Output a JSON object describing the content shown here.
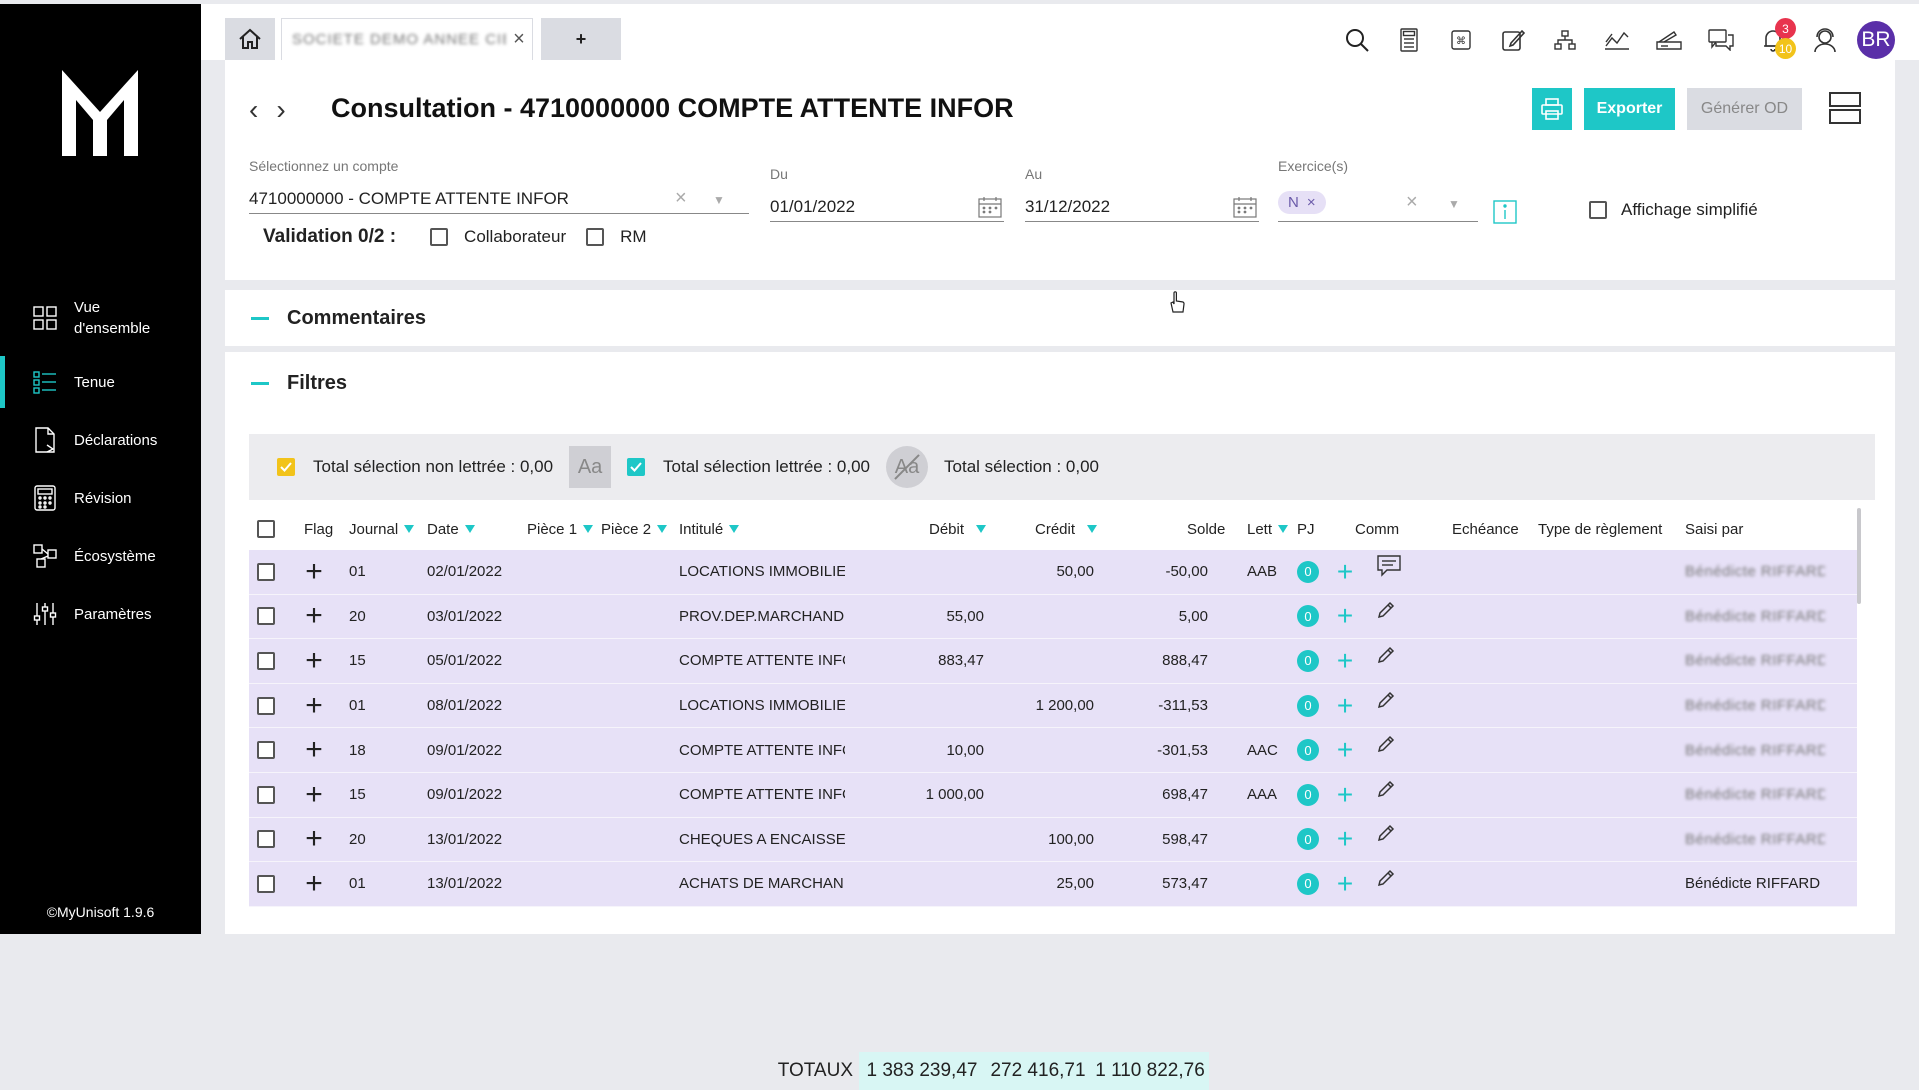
{
  "app": {
    "version": "©MyUnisoft 1.9.6",
    "logo": "MyUnisoft"
  },
  "colors": {
    "accent": "#1ec7c7",
    "sidebar": "#000000",
    "row_bg": "#e7e1f7",
    "badge_red": "#e8344e",
    "badge_yellow": "#f2c31a",
    "avatar": "#5a2fa8"
  },
  "sidebar": {
    "items": [
      {
        "label": "Vue d'ensemble",
        "icon": "grid-icon",
        "active": false
      },
      {
        "label": "Tenue",
        "icon": "list-icon",
        "active": true
      },
      {
        "label": "Déclarations",
        "icon": "document-icon",
        "active": false
      },
      {
        "label": "Révision",
        "icon": "calculator-icon",
        "active": false
      },
      {
        "label": "Écosystème",
        "icon": "ecosystem-icon",
        "active": false
      },
      {
        "label": "Paramètres",
        "icon": "sliders-icon",
        "active": false
      }
    ]
  },
  "tabs": {
    "home_icon": "home-icon",
    "doc_tab_label": "SOCIETE DEMO ANNEE CIBLE",
    "plus_label": "+"
  },
  "toolbar": {
    "icons": [
      "search-icon",
      "calculator-icon",
      "command-icon",
      "edit-icon",
      "network-icon",
      "chart-icon",
      "scanner-icon",
      "chat-icon",
      "bell-icon",
      "support-icon"
    ],
    "notif_red": "3",
    "notif_yellow": "10",
    "avatar": "BR"
  },
  "header": {
    "prev": "‹",
    "next": "›",
    "title": "Consultation - 4710000000 COMPTE ATTENTE INFOR",
    "export_label": "Exporter",
    "od_label": "Générer OD"
  },
  "form": {
    "account_label": "Sélectionnez un compte",
    "account_value": "4710000000 - COMPTE ATTENTE INFOR",
    "du_label": "Du",
    "du_value": "01/01/2022",
    "au_label": "Au",
    "au_value": "31/12/2022",
    "exercice_label": "Exercice(s)",
    "exercice_chip": "N",
    "simplified_label": "Affichage simplifié",
    "validation_label": "Validation 0/2 :",
    "collab_label": "Collaborateur",
    "rm_label": "RM"
  },
  "sections": {
    "comments": "Commentaires",
    "filters": "Filtres"
  },
  "selection": {
    "non_lettree": "Total sélection non lettrée : 0,00",
    "aa": "Aa",
    "lettree": "Total sélection lettrée : 0,00",
    "total": "Total sélection : 0,00"
  },
  "table": {
    "headers": {
      "flag": "Flag",
      "journal": "Journal",
      "date": "Date",
      "piece1": "Pièce 1",
      "piece2": "Pièce 2",
      "intitule": "Intitulé",
      "debit": "Débit",
      "credit": "Crédit",
      "solde": "Solde",
      "lett": "Lett",
      "pj": "PJ",
      "comm": "Comm",
      "echeance": "Echéance",
      "type_reglement": "Type de règlement",
      "saisi_par": "Saisi par"
    },
    "rows": [
      {
        "journal": "01",
        "date": "02/01/2022",
        "intitule": "LOCATIONS IMMOBILIE",
        "debit": "",
        "credit": "50,00",
        "solde": "-50,00",
        "lett": "AAB",
        "pj": "0",
        "comm": "comment-icon",
        "saisi": "Bénédicte RIFFARD",
        "blur": true
      },
      {
        "journal": "20",
        "date": "03/01/2022",
        "intitule": "PROV.DEP.MARCHANDI",
        "debit": "55,00",
        "credit": "",
        "solde": "5,00",
        "lett": "",
        "pj": "0",
        "comm": "pencil-icon",
        "saisi": "Bénédicte RIFFARD",
        "blur": true
      },
      {
        "journal": "15",
        "date": "05/01/2022",
        "intitule": "COMPTE ATTENTE INFC",
        "debit": "883,47",
        "credit": "",
        "solde": "888,47",
        "lett": "",
        "pj": "0",
        "comm": "pencil-icon",
        "saisi": "Bénédicte RIFFARD",
        "blur": true
      },
      {
        "journal": "01",
        "date": "08/01/2022",
        "intitule": "LOCATIONS IMMOBILIE",
        "debit": "",
        "credit": "1 200,00",
        "solde": "-311,53",
        "lett": "",
        "pj": "0",
        "comm": "pencil-icon",
        "saisi": "Bénédicte RIFFARD",
        "blur": true
      },
      {
        "journal": "18",
        "date": "09/01/2022",
        "intitule": "COMPTE ATTENTE INFC",
        "debit": "10,00",
        "credit": "",
        "solde": "-301,53",
        "lett": "AAC",
        "pj": "0",
        "comm": "pencil-icon",
        "saisi": "Bénédicte RIFFARD",
        "blur": true
      },
      {
        "journal": "15",
        "date": "09/01/2022",
        "intitule": "COMPTE ATTENTE INFC",
        "debit": "1 000,00",
        "credit": "",
        "solde": "698,47",
        "lett": "AAA",
        "pj": "0",
        "comm": "pencil-icon",
        "saisi": "Bénédicte RIFFARD",
        "blur": true
      },
      {
        "journal": "20",
        "date": "13/01/2022",
        "intitule": "CHEQUES A ENCAISSEI",
        "debit": "",
        "credit": "100,00",
        "solde": "598,47",
        "lett": "",
        "pj": "0",
        "comm": "pencil-icon",
        "saisi": "Bénédicte RIFFARD",
        "blur": true
      },
      {
        "journal": "01",
        "date": "13/01/2022",
        "intitule": "ACHATS DE MARCHANI",
        "debit": "",
        "credit": "25,00",
        "solde": "573,47",
        "lett": "",
        "pj": "0",
        "comm": "pencil-icon",
        "saisi": "Bénédicte RIFFARD",
        "blur": false
      }
    ],
    "totals": {
      "label": "TOTAUX",
      "debit": "1 383 239,47",
      "credit": "272 416,71",
      "solde": "1 110 822,76"
    }
  }
}
